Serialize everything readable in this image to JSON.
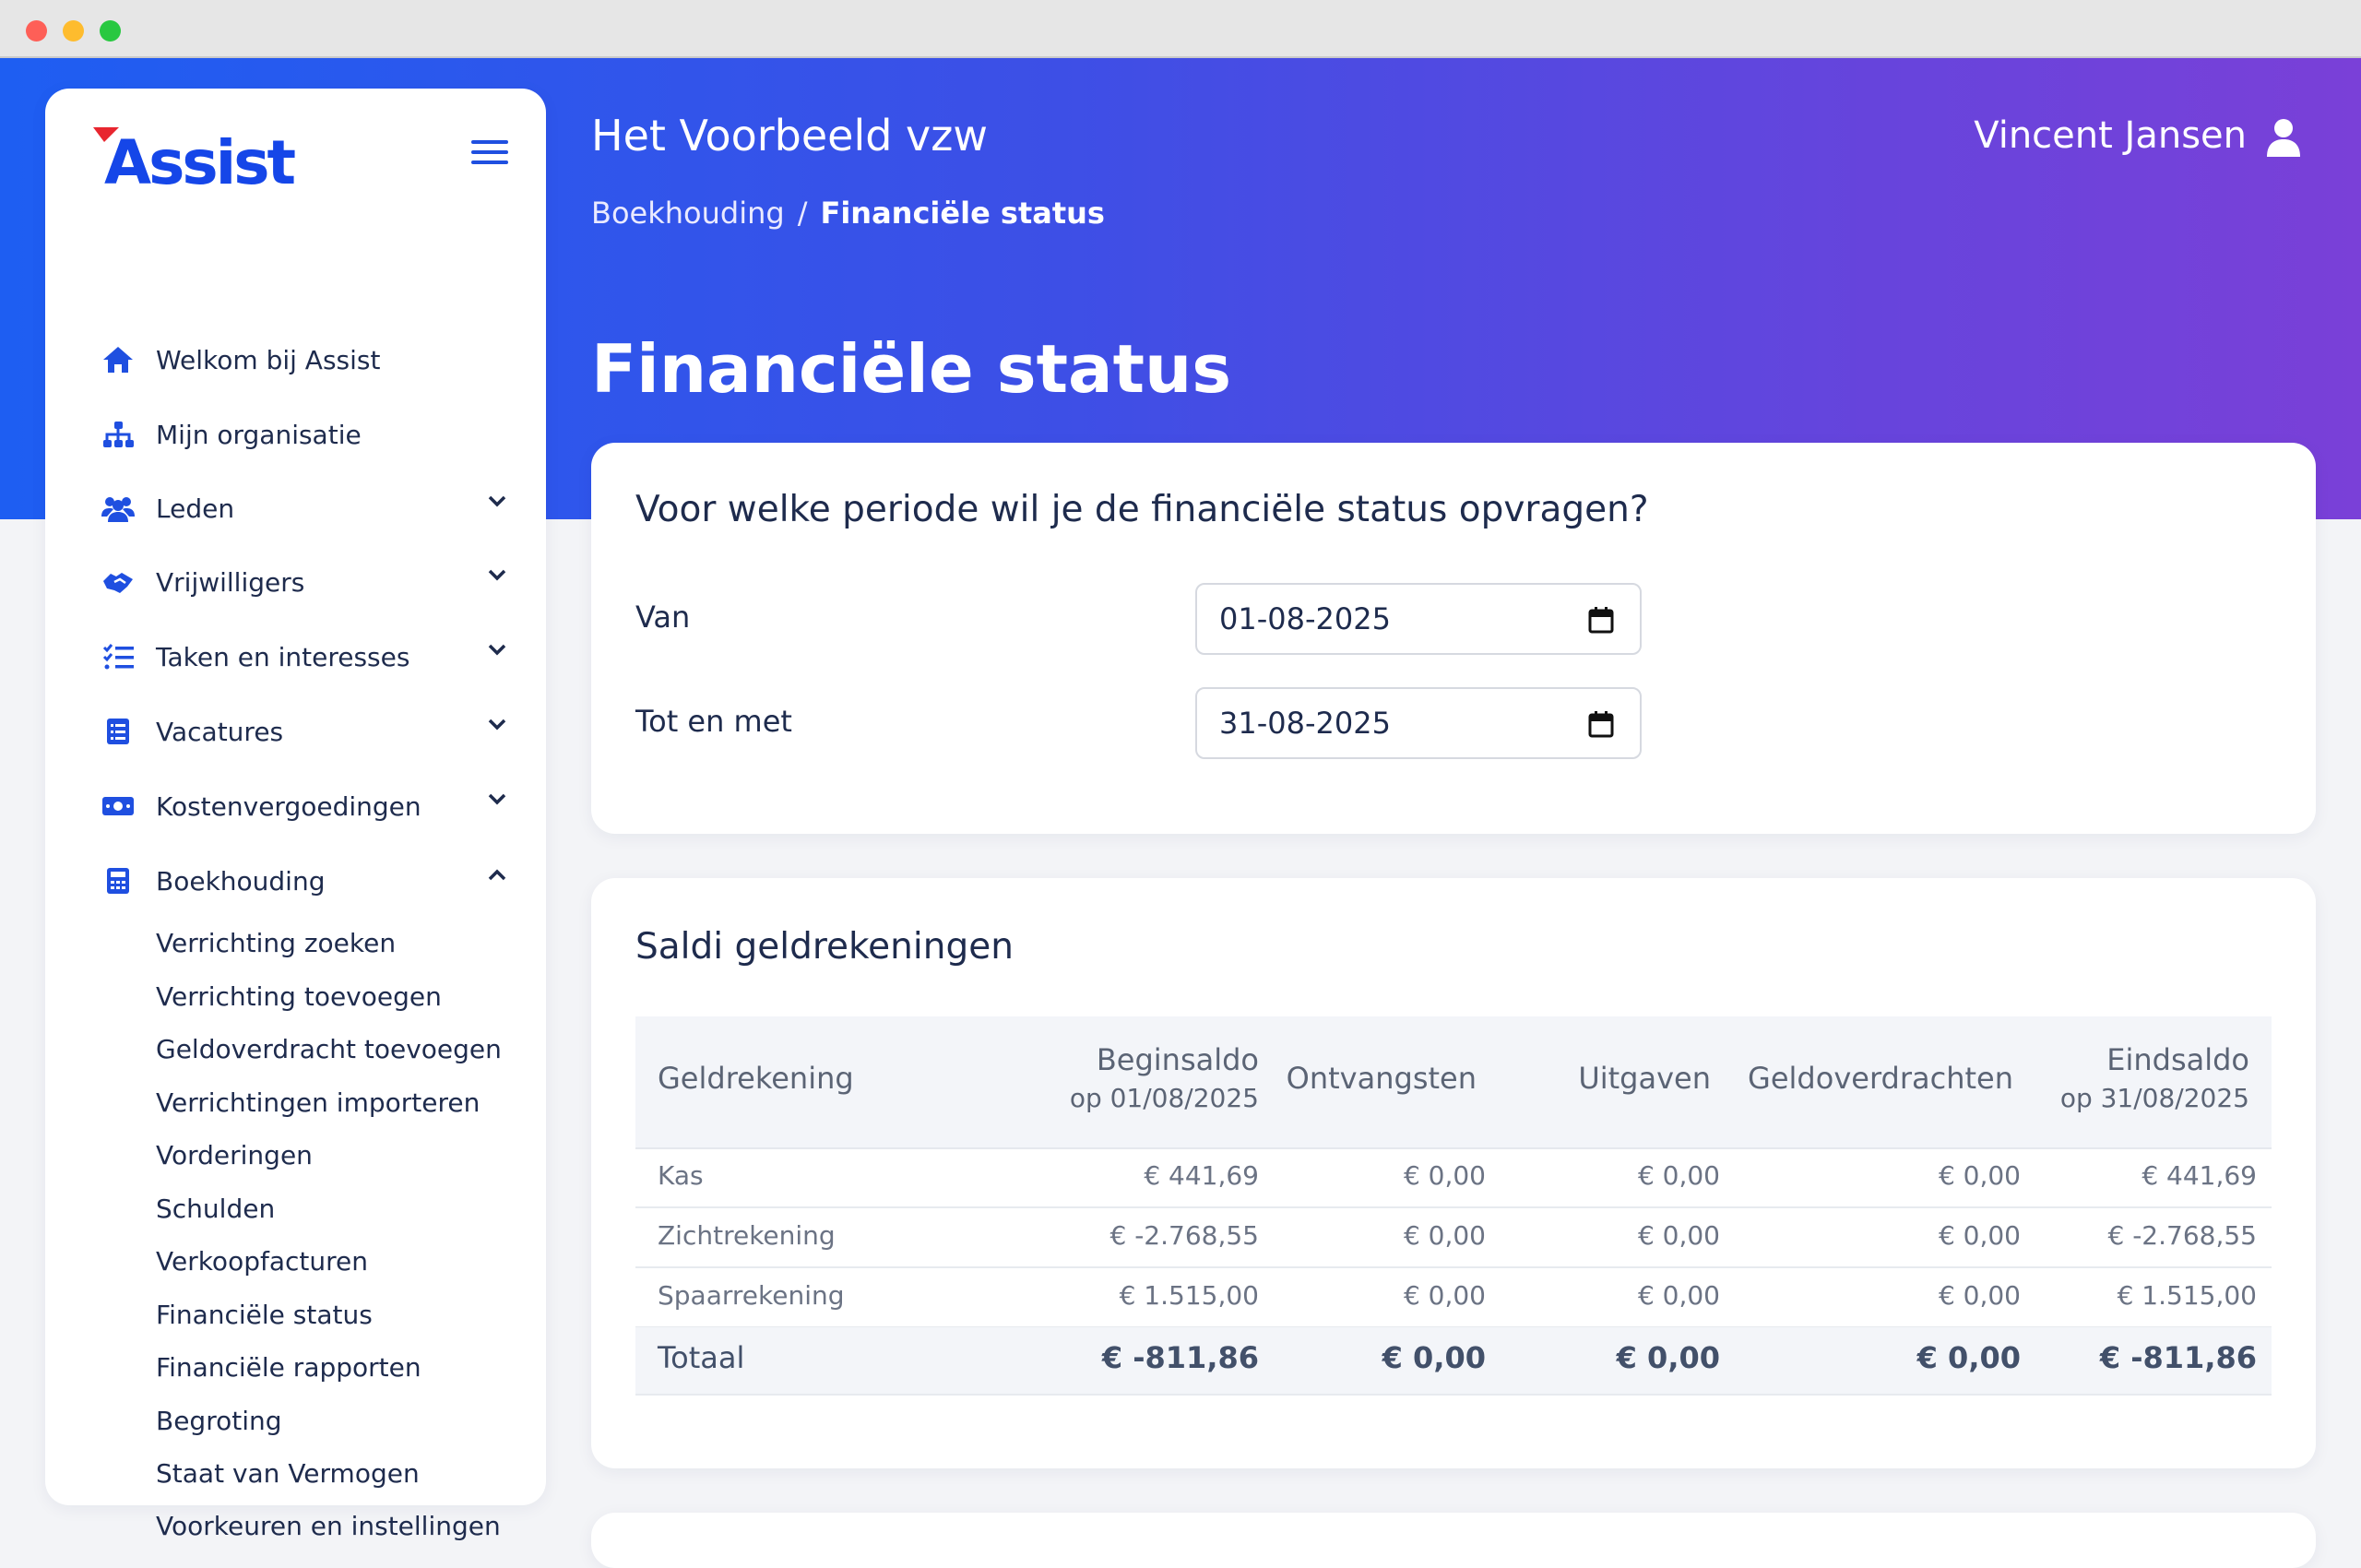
{
  "app": {
    "brand": "Assist"
  },
  "header": {
    "org_name": "Het Voorbeeld vzw",
    "breadcrumb": [
      "Boekhouding",
      "Financiële status"
    ],
    "breadcrumb_sep": "/",
    "user_name": "Vincent Jansen",
    "page_title": "Financiële status"
  },
  "sidebar": {
    "items": [
      {
        "label": "Welkom bij Assist",
        "icon": "home-icon",
        "expandable": false
      },
      {
        "label": "Mijn organisatie",
        "icon": "org-chart-icon",
        "expandable": false
      },
      {
        "label": "Leden",
        "icon": "users-icon",
        "expandable": true
      },
      {
        "label": "Vrijwilligers",
        "icon": "handshake-icon",
        "expandable": true
      },
      {
        "label": "Taken en interesses",
        "icon": "tasks-icon",
        "expandable": true
      },
      {
        "label": "Vacatures",
        "icon": "list-icon",
        "expandable": true
      },
      {
        "label": "Kostenvergoedingen",
        "icon": "money-icon",
        "expandable": true
      },
      {
        "label": "Boekhouding",
        "icon": "calculator-icon",
        "expandable": true,
        "expanded": true
      }
    ],
    "subitems": [
      "Verrichting zoeken",
      "Verrichting toevoegen",
      "Geldoverdracht toevoegen",
      "Verrichtingen importeren",
      "Vorderingen",
      "Schulden",
      "Verkoopfacturen",
      "Financiële status",
      "Financiële rapporten",
      "Begroting",
      "Staat van Vermogen",
      "Voorkeuren en instellingen"
    ]
  },
  "period_card": {
    "title": "Voor welke periode wil je de financiële status opvragen?",
    "from_label": "Van",
    "from_value": "01-08-2025",
    "to_label": "Tot en met",
    "to_value": "31-08-2025"
  },
  "balances_card": {
    "title": "Saldi geldrekeningen",
    "columns": {
      "account": "Geldrekening",
      "begin": "Beginsaldo",
      "begin_sub": "op 01/08/2025",
      "income": "Ontvangsten",
      "expenses": "Uitgaven",
      "transfers": "Geldoverdrachten",
      "end": "Eindsaldo",
      "end_sub": "op 31/08/2025"
    },
    "rows": [
      [
        "Kas",
        "€ 441,69",
        "€ 0,00",
        "€ 0,00",
        "€ 0,00",
        "€ 441,69"
      ],
      [
        "Zichtrekening",
        "€ -2.768,55",
        "€ 0,00",
        "€ 0,00",
        "€ 0,00",
        "€ -2.768,55"
      ],
      [
        "Spaarrekening",
        "€ 1.515,00",
        "€ 0,00",
        "€ 0,00",
        "€ 0,00",
        "€ 1.515,00"
      ]
    ],
    "total": [
      "Totaal",
      "€ -811,86",
      "€ 0,00",
      "€ 0,00",
      "€ 0,00",
      "€ -811,86"
    ]
  },
  "colors": {
    "accent": "#1f4fe0",
    "gradient_start": "#1e5ef2",
    "gradient_end": "#7a40d8"
  }
}
